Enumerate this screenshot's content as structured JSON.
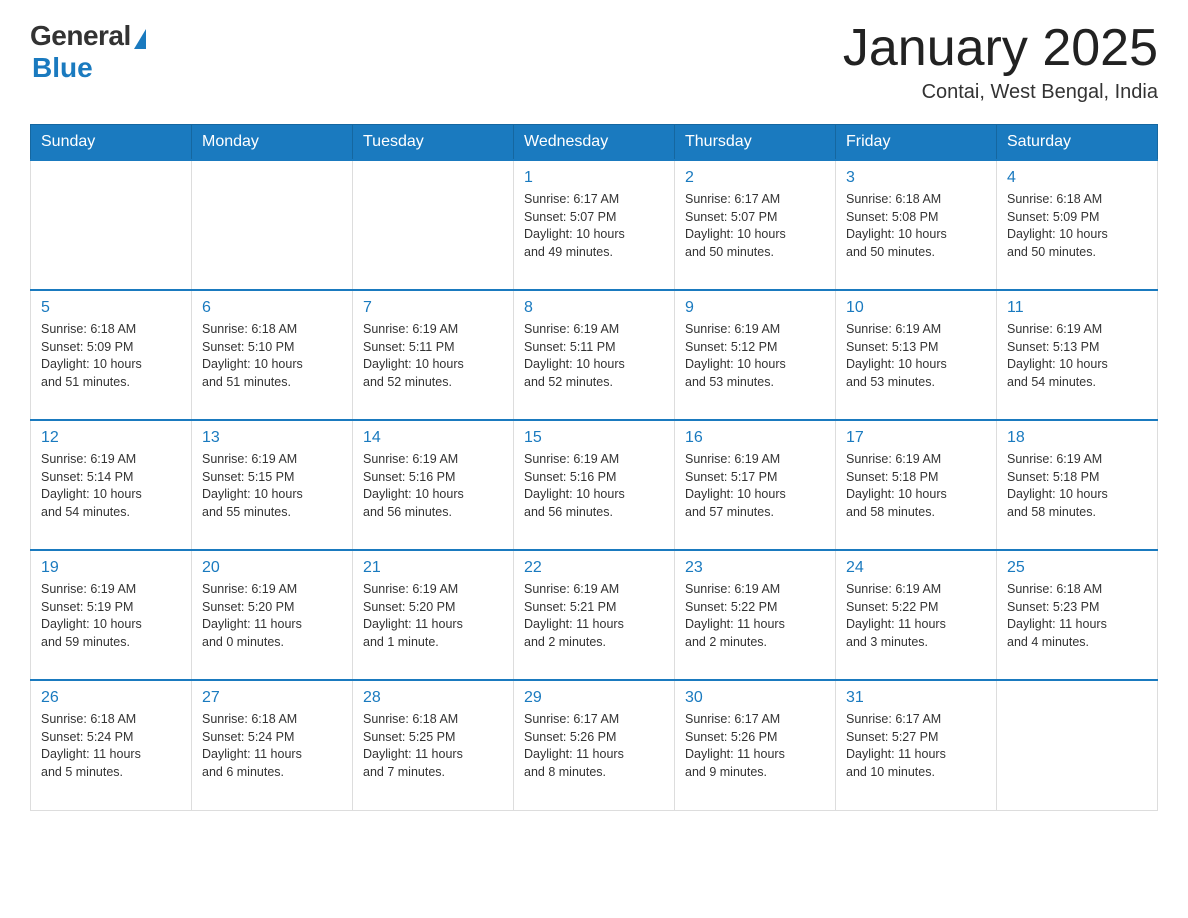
{
  "header": {
    "logo_general": "General",
    "logo_blue": "Blue",
    "month_title": "January 2025",
    "subtitle": "Contai, West Bengal, India"
  },
  "days_of_week": [
    "Sunday",
    "Monday",
    "Tuesday",
    "Wednesday",
    "Thursday",
    "Friday",
    "Saturday"
  ],
  "weeks": [
    [
      {
        "day": "",
        "info": ""
      },
      {
        "day": "",
        "info": ""
      },
      {
        "day": "",
        "info": ""
      },
      {
        "day": "1",
        "info": "Sunrise: 6:17 AM\nSunset: 5:07 PM\nDaylight: 10 hours\nand 49 minutes."
      },
      {
        "day": "2",
        "info": "Sunrise: 6:17 AM\nSunset: 5:07 PM\nDaylight: 10 hours\nand 50 minutes."
      },
      {
        "day": "3",
        "info": "Sunrise: 6:18 AM\nSunset: 5:08 PM\nDaylight: 10 hours\nand 50 minutes."
      },
      {
        "day": "4",
        "info": "Sunrise: 6:18 AM\nSunset: 5:09 PM\nDaylight: 10 hours\nand 50 minutes."
      }
    ],
    [
      {
        "day": "5",
        "info": "Sunrise: 6:18 AM\nSunset: 5:09 PM\nDaylight: 10 hours\nand 51 minutes."
      },
      {
        "day": "6",
        "info": "Sunrise: 6:18 AM\nSunset: 5:10 PM\nDaylight: 10 hours\nand 51 minutes."
      },
      {
        "day": "7",
        "info": "Sunrise: 6:19 AM\nSunset: 5:11 PM\nDaylight: 10 hours\nand 52 minutes."
      },
      {
        "day": "8",
        "info": "Sunrise: 6:19 AM\nSunset: 5:11 PM\nDaylight: 10 hours\nand 52 minutes."
      },
      {
        "day": "9",
        "info": "Sunrise: 6:19 AM\nSunset: 5:12 PM\nDaylight: 10 hours\nand 53 minutes."
      },
      {
        "day": "10",
        "info": "Sunrise: 6:19 AM\nSunset: 5:13 PM\nDaylight: 10 hours\nand 53 minutes."
      },
      {
        "day": "11",
        "info": "Sunrise: 6:19 AM\nSunset: 5:13 PM\nDaylight: 10 hours\nand 54 minutes."
      }
    ],
    [
      {
        "day": "12",
        "info": "Sunrise: 6:19 AM\nSunset: 5:14 PM\nDaylight: 10 hours\nand 54 minutes."
      },
      {
        "day": "13",
        "info": "Sunrise: 6:19 AM\nSunset: 5:15 PM\nDaylight: 10 hours\nand 55 minutes."
      },
      {
        "day": "14",
        "info": "Sunrise: 6:19 AM\nSunset: 5:16 PM\nDaylight: 10 hours\nand 56 minutes."
      },
      {
        "day": "15",
        "info": "Sunrise: 6:19 AM\nSunset: 5:16 PM\nDaylight: 10 hours\nand 56 minutes."
      },
      {
        "day": "16",
        "info": "Sunrise: 6:19 AM\nSunset: 5:17 PM\nDaylight: 10 hours\nand 57 minutes."
      },
      {
        "day": "17",
        "info": "Sunrise: 6:19 AM\nSunset: 5:18 PM\nDaylight: 10 hours\nand 58 minutes."
      },
      {
        "day": "18",
        "info": "Sunrise: 6:19 AM\nSunset: 5:18 PM\nDaylight: 10 hours\nand 58 minutes."
      }
    ],
    [
      {
        "day": "19",
        "info": "Sunrise: 6:19 AM\nSunset: 5:19 PM\nDaylight: 10 hours\nand 59 minutes."
      },
      {
        "day": "20",
        "info": "Sunrise: 6:19 AM\nSunset: 5:20 PM\nDaylight: 11 hours\nand 0 minutes."
      },
      {
        "day": "21",
        "info": "Sunrise: 6:19 AM\nSunset: 5:20 PM\nDaylight: 11 hours\nand 1 minute."
      },
      {
        "day": "22",
        "info": "Sunrise: 6:19 AM\nSunset: 5:21 PM\nDaylight: 11 hours\nand 2 minutes."
      },
      {
        "day": "23",
        "info": "Sunrise: 6:19 AM\nSunset: 5:22 PM\nDaylight: 11 hours\nand 2 minutes."
      },
      {
        "day": "24",
        "info": "Sunrise: 6:19 AM\nSunset: 5:22 PM\nDaylight: 11 hours\nand 3 minutes."
      },
      {
        "day": "25",
        "info": "Sunrise: 6:18 AM\nSunset: 5:23 PM\nDaylight: 11 hours\nand 4 minutes."
      }
    ],
    [
      {
        "day": "26",
        "info": "Sunrise: 6:18 AM\nSunset: 5:24 PM\nDaylight: 11 hours\nand 5 minutes."
      },
      {
        "day": "27",
        "info": "Sunrise: 6:18 AM\nSunset: 5:24 PM\nDaylight: 11 hours\nand 6 minutes."
      },
      {
        "day": "28",
        "info": "Sunrise: 6:18 AM\nSunset: 5:25 PM\nDaylight: 11 hours\nand 7 minutes."
      },
      {
        "day": "29",
        "info": "Sunrise: 6:17 AM\nSunset: 5:26 PM\nDaylight: 11 hours\nand 8 minutes."
      },
      {
        "day": "30",
        "info": "Sunrise: 6:17 AM\nSunset: 5:26 PM\nDaylight: 11 hours\nand 9 minutes."
      },
      {
        "day": "31",
        "info": "Sunrise: 6:17 AM\nSunset: 5:27 PM\nDaylight: 11 hours\nand 10 minutes."
      },
      {
        "day": "",
        "info": ""
      }
    ]
  ]
}
